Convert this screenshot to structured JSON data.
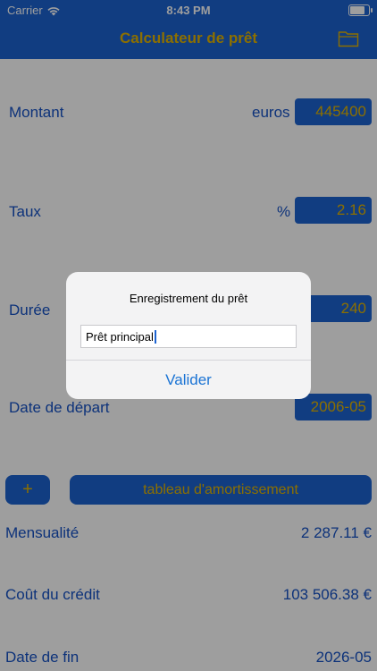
{
  "status_bar": {
    "carrier": "Carrier",
    "time": "8:43 PM",
    "battery_level": 0.9
  },
  "nav": {
    "title": "Calculateur de prêt",
    "folder_icon": "folder-icon"
  },
  "form": {
    "montant": {
      "label": "Montant",
      "unit": "euros",
      "value": "445400"
    },
    "taux": {
      "label": "Taux",
      "unit": "%",
      "value": "2.16"
    },
    "duree": {
      "label": "Durée",
      "value": "240"
    },
    "date_depart": {
      "label": "Date de départ",
      "value": "2006-05"
    }
  },
  "buttons": {
    "plus": "+",
    "table": "tableau d'amortissement"
  },
  "results": {
    "mensualite": {
      "label": "Mensualité",
      "value": "2 287.11 €"
    },
    "cout": {
      "label": "Coût du crédit",
      "value": "103 506.38 €"
    },
    "date_fin": {
      "label": "Date de fin",
      "value": "2026-05"
    }
  },
  "alert": {
    "title": "Enregistrement du prêt",
    "input_value": "Prêt principal",
    "button": "Valider"
  },
  "colors": {
    "primary": "#1c63d1",
    "accent": "#e2b400",
    "text": "#1552c5"
  }
}
